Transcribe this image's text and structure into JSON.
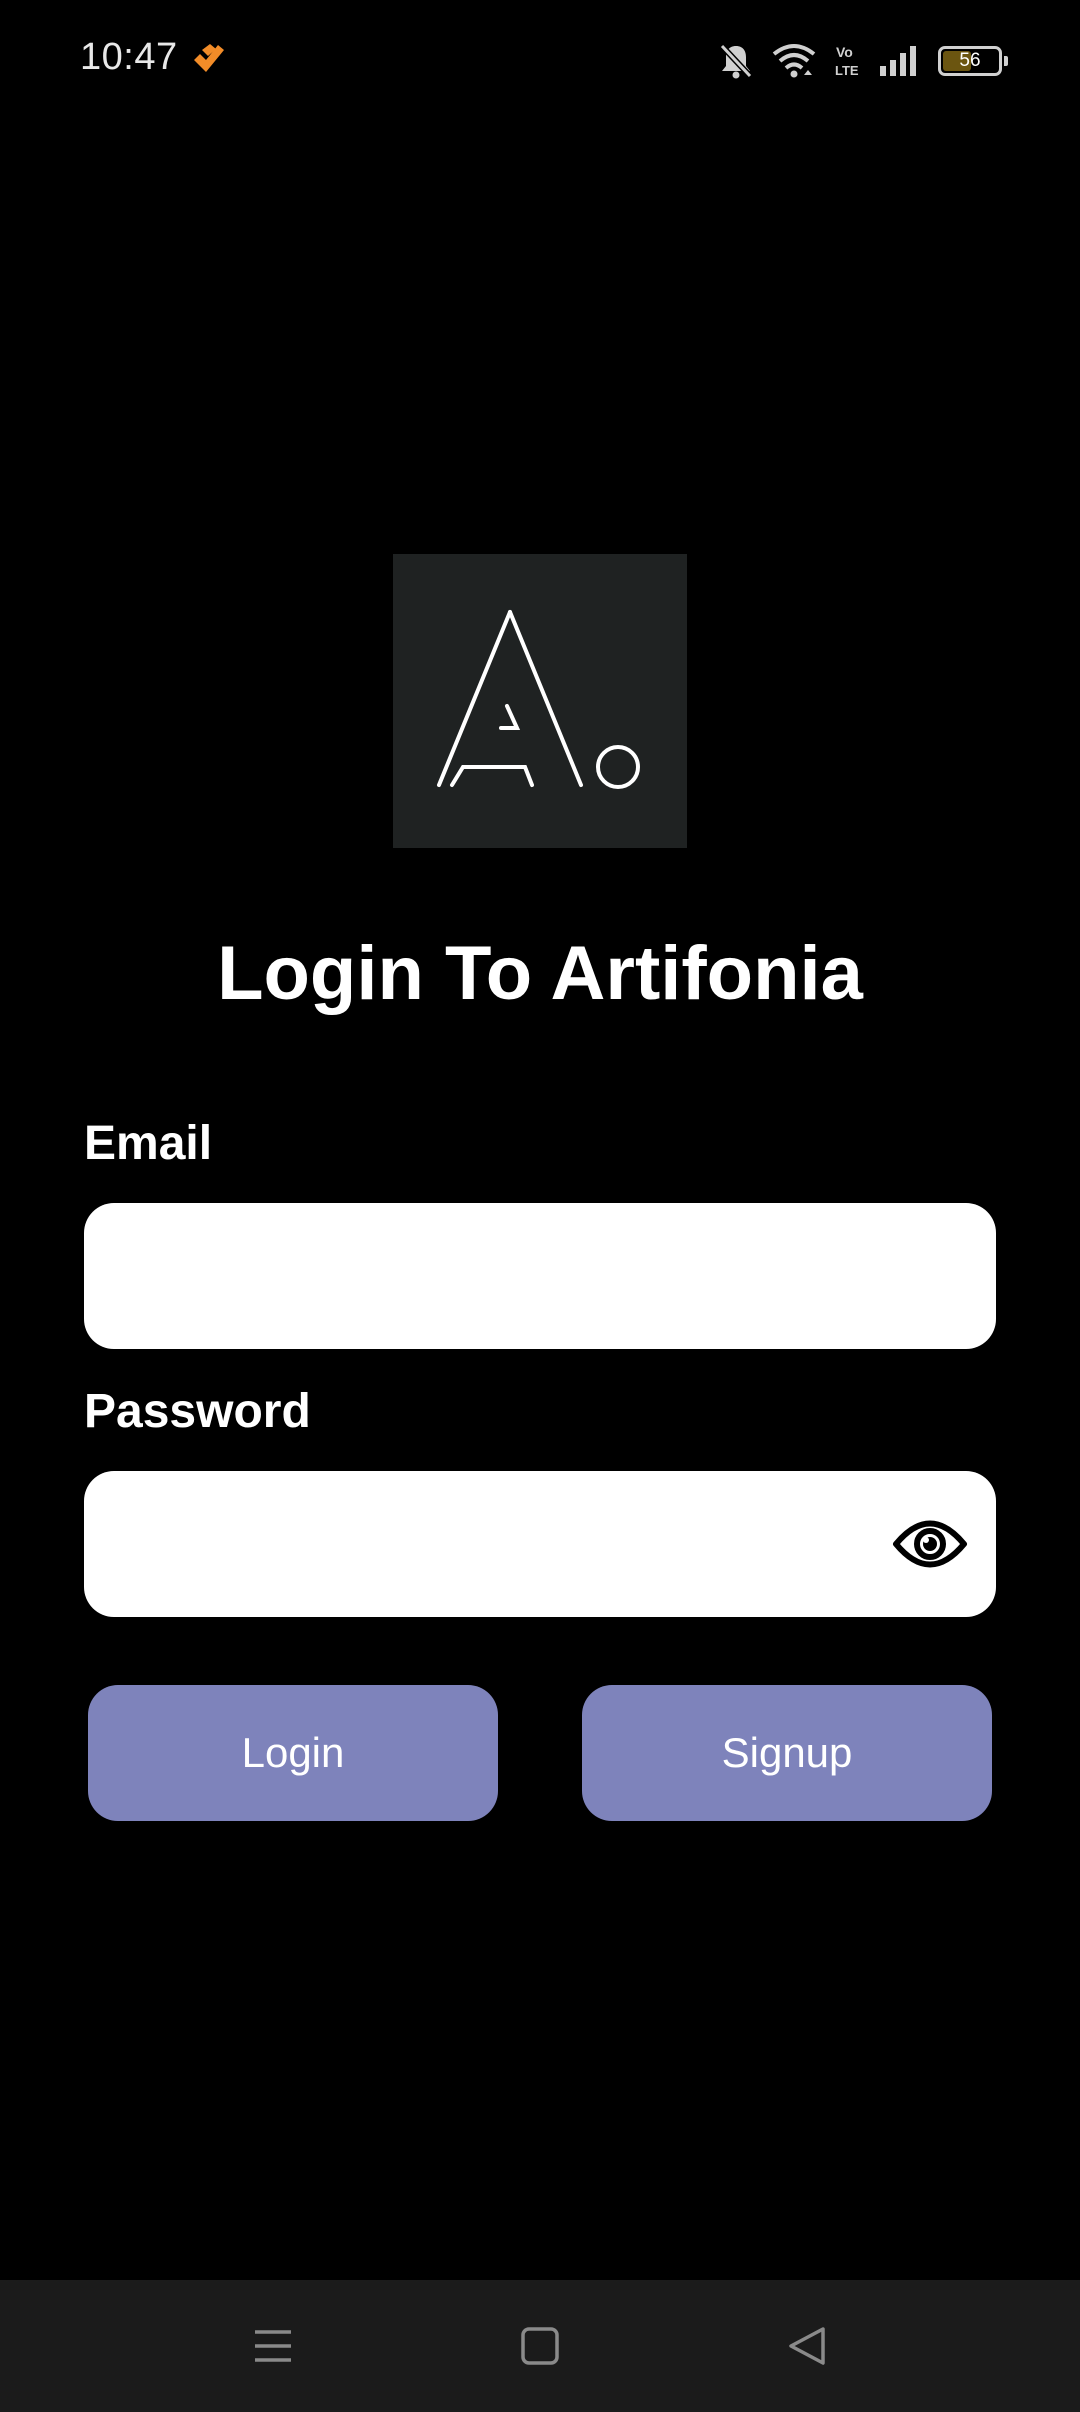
{
  "status_bar": {
    "time": "10:47",
    "battery_level": "56",
    "battery_fraction": 0.56,
    "icons": [
      "app-notification-icon",
      "mute-icon",
      "wifi-icon",
      "volte-icon",
      "signal-icon",
      "battery-icon"
    ]
  },
  "logo": {
    "icon": "artifonia-logo",
    "background": "#1f2222"
  },
  "title": "Login To Artifonia",
  "form": {
    "email_label": "Email",
    "email_value": "",
    "password_label": "Password",
    "password_value": "",
    "password_toggle_icon": "eye-icon"
  },
  "buttons": {
    "login_label": "Login",
    "signup_label": "Signup"
  },
  "nav_bar": {
    "icons": [
      "menu-icon",
      "home-icon",
      "back-icon"
    ]
  },
  "colors": {
    "background": "#000000",
    "button": "#7e83bb",
    "input": "#ffffff",
    "accent_icon": "#f28c28"
  }
}
